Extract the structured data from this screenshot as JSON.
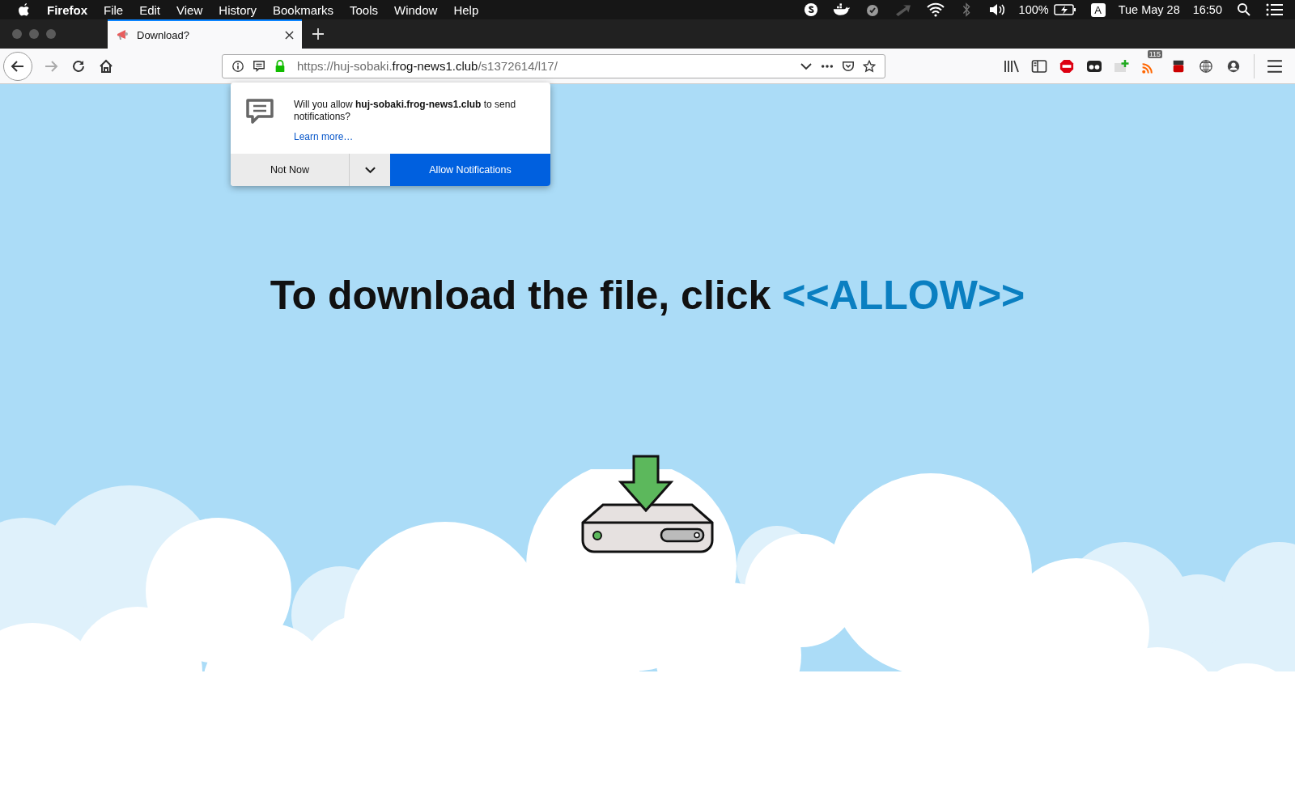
{
  "menu_bar": {
    "app": "Firefox",
    "items": [
      "File",
      "Edit",
      "View",
      "History",
      "Bookmarks",
      "Tools",
      "Window",
      "Help"
    ],
    "battery_percent": "100%",
    "input_source": "A",
    "date": "Tue May 28",
    "time": "16:50"
  },
  "tabs": [
    {
      "title": "Download?",
      "selected": true
    }
  ],
  "url": {
    "start": "https://huj-sobaki.",
    "domain": "frog-news1.club",
    "path": "/s1372614/l17/"
  },
  "toolbar": {
    "feed_badge": "115"
  },
  "popup": {
    "message": "Will you allow **huj-sobaki.frog-news1.club** to send notifications?",
    "link": "Learn more…",
    "secondary": "Not Now",
    "primary": "Allow Notifications"
  },
  "headline": {
    "text": "To download the file, click",
    "highlight": "<<ALLOW>>"
  }
}
